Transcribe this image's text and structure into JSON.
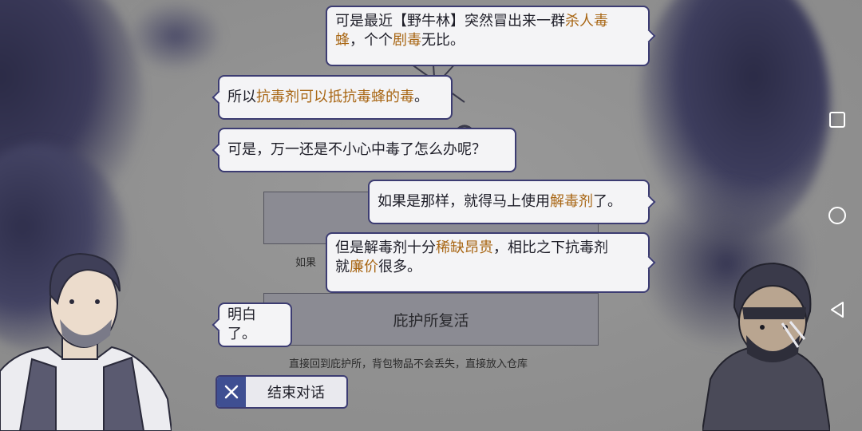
{
  "dialogue": {
    "lines": [
      {
        "speaker": "right",
        "segments": [
          {
            "text": "可是最近【野牛林】突然冒出来一群",
            "highlight": false
          },
          {
            "text": "杀人毒",
            "highlight": true
          }
        ],
        "segments2": [
          {
            "text": "蜂",
            "highlight": true
          },
          {
            "text": "，个个",
            "highlight": false
          },
          {
            "text": "剧毒",
            "highlight": true
          },
          {
            "text": "无比。",
            "highlight": false
          }
        ]
      },
      {
        "speaker": "left",
        "segments": [
          {
            "text": "所以",
            "highlight": false
          },
          {
            "text": "抗毒剂可以抵抗毒蜂的毒",
            "highlight": true
          },
          {
            "text": "。",
            "highlight": false
          }
        ]
      },
      {
        "speaker": "left",
        "segments": [
          {
            "text": "可是，万一还是不小心中毒了怎么办呢？",
            "highlight": false
          }
        ]
      },
      {
        "speaker": "right",
        "segments": [
          {
            "text": "如果是那样，就得马上使用",
            "highlight": false
          },
          {
            "text": "解毒剂",
            "highlight": true
          },
          {
            "text": "了。",
            "highlight": false
          }
        ]
      },
      {
        "speaker": "right",
        "segments": [
          {
            "text": "但是解毒剂十分",
            "highlight": false
          },
          {
            "text": "稀缺昂贵",
            "highlight": true
          },
          {
            "text": "，相比之下抗毒剂",
            "highlight": false
          }
        ],
        "segments2": [
          {
            "text": "就",
            "highlight": false
          },
          {
            "text": "廉价",
            "highlight": true
          },
          {
            "text": "很多。",
            "highlight": false
          }
        ]
      },
      {
        "speaker": "left",
        "segments": [
          {
            "text": "明白了。",
            "highlight": false
          }
        ]
      }
    ]
  },
  "background_menu": {
    "option2_label": "庇护所复活",
    "option2_hint": "直接回到庇护所，背包物品不会丢失，直接放入仓库",
    "option1_hint_visible": "如果"
  },
  "end_button": {
    "label": "结束对话",
    "icon": "close-icon"
  },
  "navigation": {
    "icons": [
      "recent-apps-icon",
      "home-icon",
      "back-icon"
    ]
  },
  "colors": {
    "highlight": "#a86614",
    "bubble_border": "#3c3c72",
    "bubble_bg": "#f4f4f6",
    "button_accent": "#3f4f92"
  }
}
